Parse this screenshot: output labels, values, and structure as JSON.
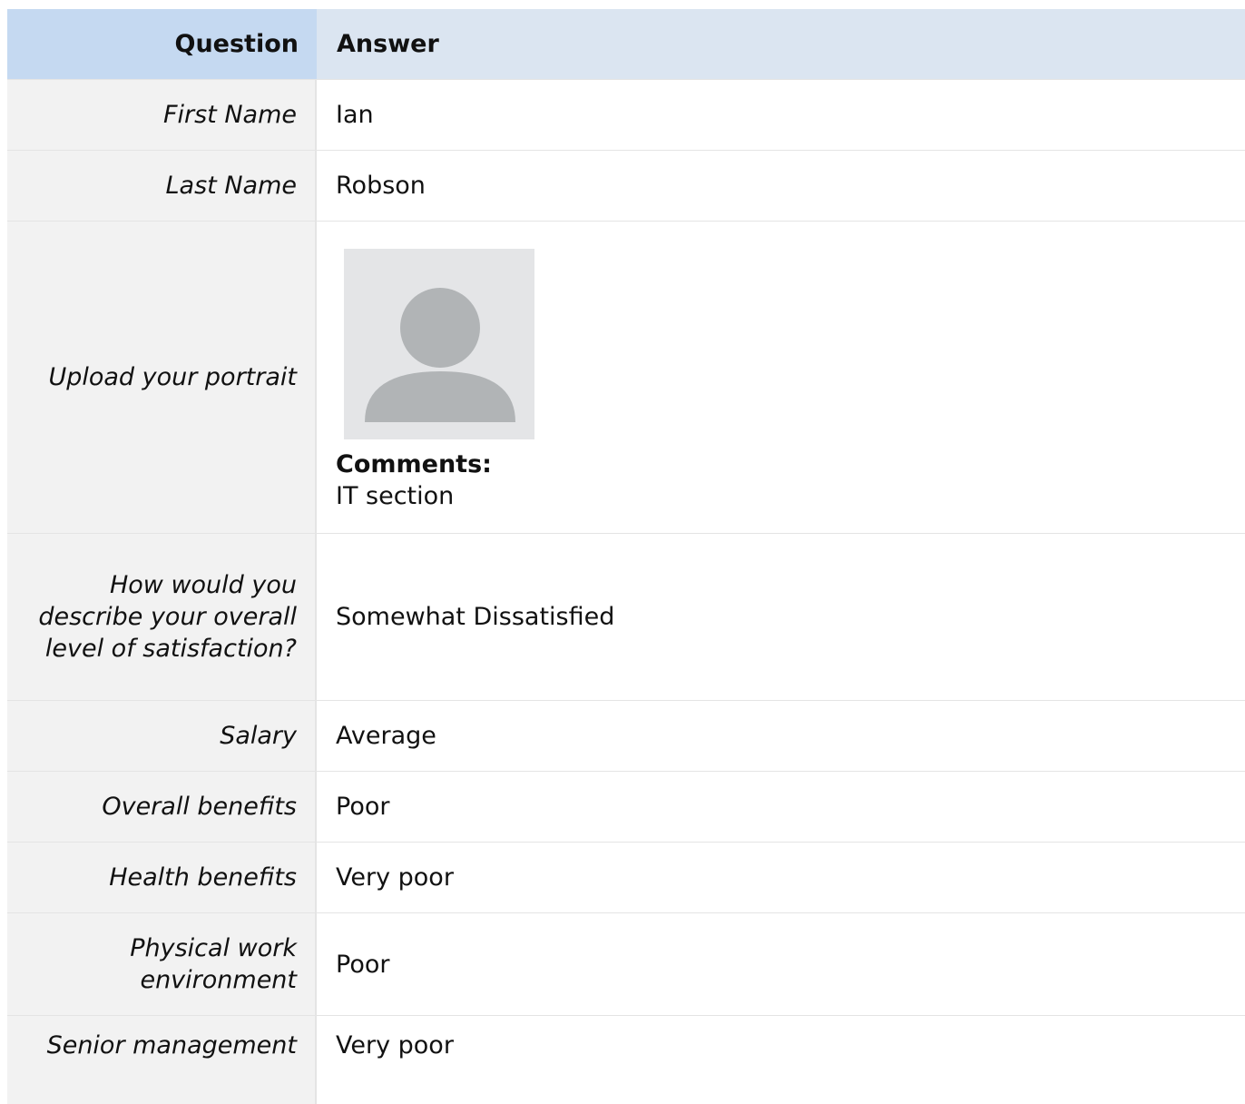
{
  "table": {
    "headers": {
      "question": "Question",
      "answer": "Answer"
    },
    "rows": [
      {
        "question": "First Name",
        "answer": "Ian"
      },
      {
        "question": "Last Name",
        "answer": "Robson"
      },
      {
        "question": "Upload your portrait",
        "answer": "",
        "comments_label": "Comments:",
        "comments": "IT section"
      },
      {
        "question": "How would you describe your overall level of satisfaction?",
        "answer": "Somewhat Dissatisfied"
      },
      {
        "question": "Salary",
        "answer": "Average"
      },
      {
        "question": "Overall benefits",
        "answer": "Poor"
      },
      {
        "question": "Health benefits",
        "answer": "Very poor"
      },
      {
        "question": "Physical work environment",
        "answer": "Poor"
      },
      {
        "question": "Senior management",
        "answer": "Very poor"
      }
    ]
  },
  "colors": {
    "header_question_bg": "#c5d9f1",
    "header_answer_bg": "#dbe5f1",
    "question_bg": "#f2f2f2",
    "answer_bg": "#ffffff",
    "border": "#e4e4e4",
    "portrait_placeholder": "#b1b4b6"
  },
  "icons": {
    "portrait": "user-avatar-placeholder-icon"
  }
}
